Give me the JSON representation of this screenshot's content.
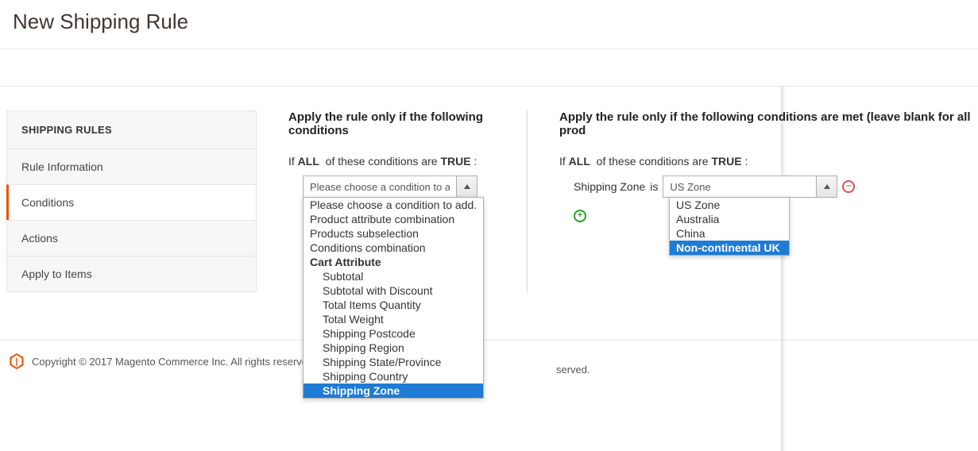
{
  "page_title": "New Shipping Rule",
  "sidebar": {
    "title": "SHIPPING RULES",
    "items": [
      {
        "label": "Rule Information"
      },
      {
        "label": "Conditions"
      },
      {
        "label": "Actions"
      },
      {
        "label": "Apply to Items"
      }
    ],
    "active_index": 1
  },
  "left_panel": {
    "heading": "Apply the rule only if the following conditions",
    "cond_prefix": "If",
    "cond_all": "ALL",
    "cond_mid": "of these conditions are",
    "cond_true": "TRUE",
    "cond_suffix": ":",
    "select_value": "Please choose a condition to add.",
    "dropdown": [
      {
        "label": "Please choose a condition to add.",
        "indent": false
      },
      {
        "label": "Product attribute combination",
        "indent": false
      },
      {
        "label": "Products subselection",
        "indent": false
      },
      {
        "label": "Conditions combination",
        "indent": false
      },
      {
        "label": "Cart Attribute",
        "group": true
      },
      {
        "label": "Subtotal",
        "indent": true
      },
      {
        "label": "Subtotal with Discount",
        "indent": true
      },
      {
        "label": "Total Items Quantity",
        "indent": true
      },
      {
        "label": "Total Weight",
        "indent": true
      },
      {
        "label": "Shipping Postcode",
        "indent": true
      },
      {
        "label": "Shipping Region",
        "indent": true
      },
      {
        "label": "Shipping State/Province",
        "indent": true
      },
      {
        "label": "Shipping Country",
        "indent": true
      },
      {
        "label": "Shipping Zone",
        "indent": true,
        "selected": true
      }
    ]
  },
  "right_panel": {
    "heading": "Apply the rule only if the following conditions are met (leave blank for all prod",
    "cond_prefix": "If",
    "cond_all": "ALL",
    "cond_mid": "of these conditions are",
    "cond_true": "TRUE",
    "cond_suffix": ":",
    "cond_attr": "Shipping Zone",
    "cond_op": "is",
    "cond_value": "US Zone",
    "dropdown": [
      {
        "label": "US Zone"
      },
      {
        "label": "Australia"
      },
      {
        "label": "China"
      },
      {
        "label": "Non-continental UK",
        "selected": true
      }
    ]
  },
  "footer": {
    "copyright": "Copyright © 2017 Magento Commerce Inc. All rights reserved.",
    "right_fragment": "served."
  }
}
